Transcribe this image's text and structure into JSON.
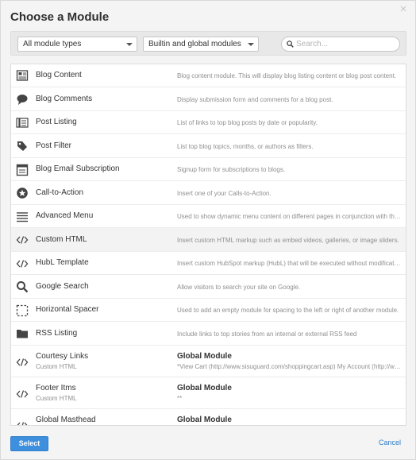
{
  "dialog": {
    "title": "Choose a Module",
    "close_label": "×",
    "select_label": "Select",
    "cancel_label": "Cancel"
  },
  "filters": {
    "module_type": "All module types",
    "module_scope": "Builtin and global modules",
    "search_placeholder": "Search..."
  },
  "modules": [
    {
      "name": "Blog Content",
      "icon": "blog-content-icon",
      "description": "Blog content module. This will display blog listing content or blog post content."
    },
    {
      "name": "Blog Comments",
      "icon": "speech-bubble-icon",
      "description": "Display submission form and comments for a blog post."
    },
    {
      "name": "Post Listing",
      "icon": "post-listing-icon",
      "description": "List of links to top blog posts by date or popularity."
    },
    {
      "name": "Post Filter",
      "icon": "tag-icon",
      "description": "List top blog topics, months, or authors as filters."
    },
    {
      "name": "Blog Email Subscription",
      "icon": "newsletter-icon",
      "description": "Signup form for subscriptions to blogs."
    },
    {
      "name": "Call-to-Action",
      "icon": "star-circle-icon",
      "description": "Insert one of your Calls-to-Action."
    },
    {
      "name": "Advanced Menu",
      "icon": "menu-lines-icon",
      "description": "Used to show dynamic menu content on different pages in conjunction with the menu tool."
    },
    {
      "name": "Custom HTML",
      "icon": "code-icon",
      "description": "Insert custom HTML markup such as embed videos, galleries, or image sliders."
    },
    {
      "name": "HubL Template",
      "icon": "code-icon",
      "description": "Insert custom HubSpot markup (HubL) that will be executed without modification."
    },
    {
      "name": "Google Search",
      "icon": "magnifier-icon",
      "description": "Allow visitors to search your site on Google."
    },
    {
      "name": "Horizontal Spacer",
      "icon": "dashed-square-icon",
      "description": "Used to add an empty module for spacing to the left or right of another module."
    },
    {
      "name": "RSS Listing",
      "icon": "folder-icon",
      "description": "Include links to top stories from an internal or external RSS feed"
    }
  ],
  "global_modules": [
    {
      "name": "Courtesy Links",
      "type": "Custom HTML",
      "icon": "code-icon",
      "scope": "Global Module",
      "preview": "*View Cart (http://www.sisuguard.com/shoppingcart.asp) My Account (http://www.sisuguard.com/myaccount.asp)"
    },
    {
      "name": "Footer Itms",
      "type": "Custom HTML",
      "icon": "code-icon",
      "scope": "Global Module",
      "preview": "**"
    },
    {
      "name": "Global Masthead",
      "type": "",
      "icon": "code-icon",
      "scope": "Global Module",
      "preview": ""
    }
  ]
}
